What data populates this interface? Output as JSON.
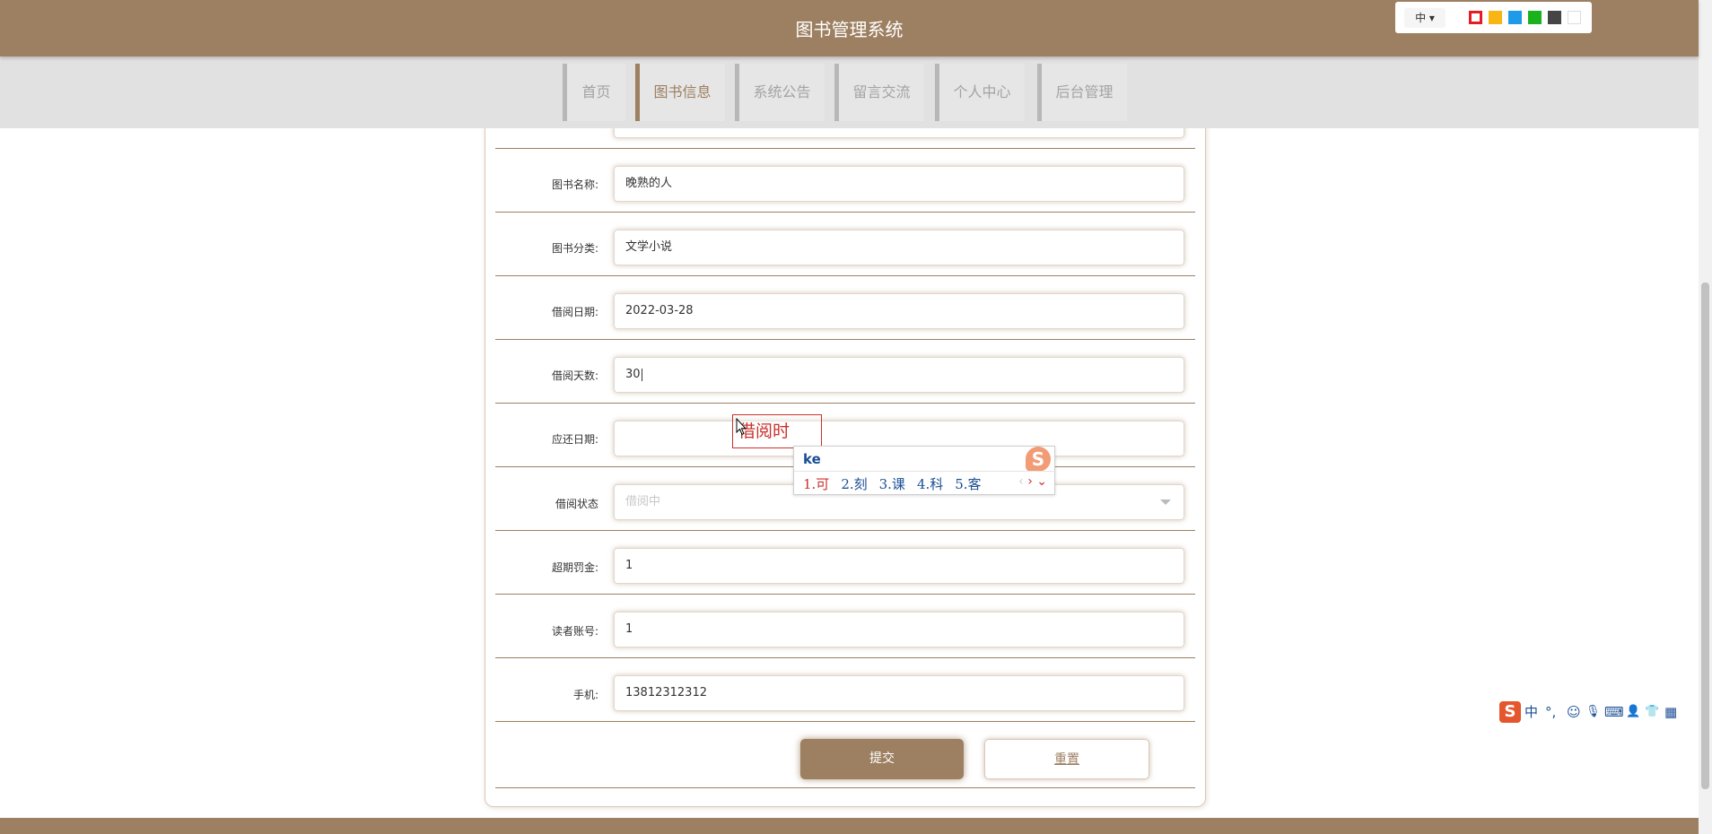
{
  "header": {
    "title": "图书管理系统",
    "language": "中",
    "theme_colors": [
      "#e51c23",
      "#f7b614",
      "#1e9ae8",
      "#1ab31d",
      "#454545",
      "#ffffff"
    ]
  },
  "nav": {
    "items": [
      {
        "label": "首页",
        "active": false
      },
      {
        "label": "图书信息",
        "active": true
      },
      {
        "label": "系统公告",
        "active": false
      },
      {
        "label": "留言交流",
        "active": false
      },
      {
        "label": "个人中心",
        "active": false
      },
      {
        "label": "后台管理",
        "active": false
      }
    ]
  },
  "form": {
    "fields": [
      {
        "label": "图书名称:",
        "value": "晚熟的人"
      },
      {
        "label": "图书分类:",
        "value": "文学小说"
      },
      {
        "label": "借阅日期:",
        "value": "2022-03-28"
      },
      {
        "label": "借阅天数:",
        "value": "30"
      },
      {
        "label": "应还日期:",
        "value": ""
      },
      {
        "label": "借阅状态",
        "value": "借阅中"
      },
      {
        "label": "超期罚金:",
        "value": "1"
      },
      {
        "label": "读者账号:",
        "value": "1"
      },
      {
        "label": "手机:",
        "value": "13812312312"
      }
    ],
    "submit_label": "提交",
    "reset_label": "重置"
  },
  "ime": {
    "preedit": "借阅时",
    "input": "ke",
    "candidates": [
      "1.可",
      "2.刻",
      "3.课",
      "4.科",
      "5.客"
    ],
    "prev_arrow": "‹",
    "next_arrow": "›",
    "expand_arrow": "⌄",
    "logo": "S"
  },
  "ime_toolbar": {
    "logo": "S",
    "mode": "中",
    "punct": "°,",
    "emoji": "☺",
    "voice": "🎙",
    "keyboard": "⌨",
    "user": "👤",
    "skin": "👕",
    "tools": "▦"
  }
}
